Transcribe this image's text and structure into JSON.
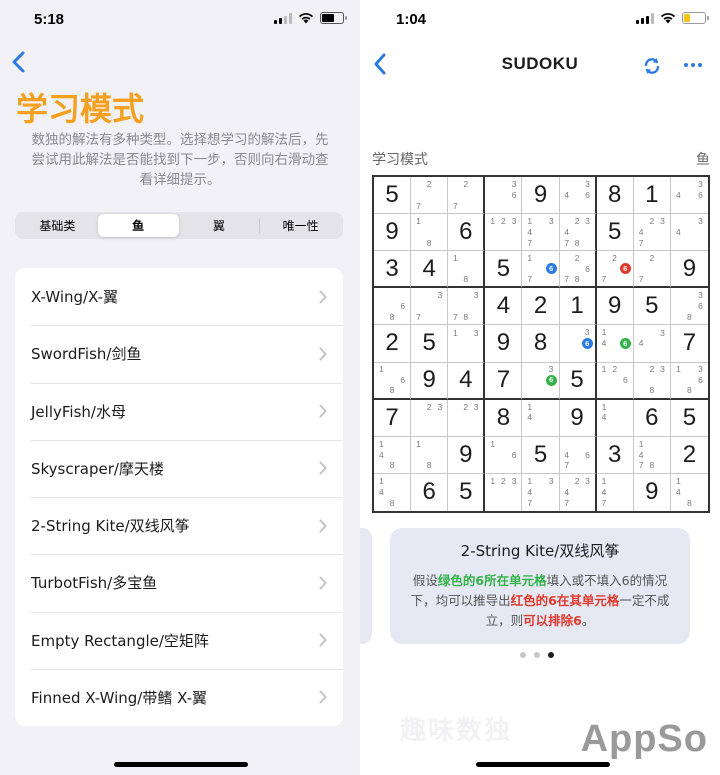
{
  "left": {
    "status": {
      "time": "5:18"
    },
    "title": "学习模式",
    "description": "数独的解法有多种类型。选择想学习的解法后，先尝试用此解法是否能找到下一步，否则向右滑动查看详细提示。",
    "segments": [
      "基础类",
      "鱼",
      "翼",
      "唯一性"
    ],
    "active_segment": 1,
    "items": [
      "X-Wing/X-翼",
      "SwordFish/剑鱼",
      "JellyFish/水母",
      "Skyscraper/摩天楼",
      "2-String Kite/双线风筝",
      "TurbotFish/多宝鱼",
      "Empty Rectangle/空矩阵",
      "Finned X-Wing/带鳍 X-翼"
    ]
  },
  "right": {
    "status": {
      "time": "1:04"
    },
    "title": "SUDOKU",
    "mode_label": "学习模式",
    "category_label": "鱼",
    "hint": {
      "title": "2-String Kite/双线风筝",
      "body_parts": [
        {
          "t": "假设",
          "c": ""
        },
        {
          "t": "绿色的6所在单元格",
          "c": "hg"
        },
        {
          "t": "填入或不填入6的情况下，均可以推导出",
          "c": ""
        },
        {
          "t": "红色的6在其单元格",
          "c": "hr"
        },
        {
          "t": "一定不成立，则",
          "c": ""
        },
        {
          "t": "可以排除6",
          "c": "hr"
        },
        {
          "t": "。",
          "c": ""
        }
      ]
    },
    "page_dots": 3,
    "active_dot": 2,
    "ghost_text": "趣味数独",
    "watermark": "AppSo"
  },
  "colors": {
    "accent_orange": "#f5a020",
    "ios_blue": "#2a7ae2",
    "green_highlight": "#34b24b",
    "red_highlight": "#e03a2c",
    "blue_highlight": "#2a7ae2"
  },
  "board": [
    [
      {
        "v": "5"
      },
      {
        "n": {
          "2": "2",
          "7": "7"
        }
      },
      {
        "n": {
          "2": "2",
          "7": "7"
        }
      },
      {
        "n": {
          "3": "3",
          "6": "6"
        }
      },
      {
        "v": "9"
      },
      {
        "n": {
          "3": "3",
          "4": "4",
          "6": "6"
        }
      },
      {
        "v": "8"
      },
      {
        "v": "1"
      },
      {
        "n": {
          "3": "3",
          "4": "4",
          "6": "6"
        }
      }
    ],
    [
      {
        "v": "9"
      },
      {
        "n": {
          "1": "1",
          "8": "8"
        }
      },
      {
        "v": "6"
      },
      {
        "n": {
          "1": "1",
          "2": "2",
          "3": "3"
        }
      },
      {
        "n": {
          "1": "1",
          "3": "3",
          "4": "4",
          "7": "7"
        }
      },
      {
        "n": {
          "2": "2",
          "3": "3",
          "4": "4",
          "7": "7",
          "8": "8"
        }
      },
      {
        "v": "5"
      },
      {
        "n": {
          "2": "2",
          "3": "3",
          "4": "4",
          "7": "7"
        }
      },
      {
        "n": {
          "3": "3",
          "4": "4"
        }
      }
    ],
    [
      {
        "v": "3"
      },
      {
        "v": "4"
      },
      {
        "n": {
          "1": "1",
          "8": "8"
        }
      },
      {
        "v": "5"
      },
      {
        "n": {
          "1": "1",
          "6": "6*b",
          "7": "7"
        }
      },
      {
        "n": {
          "2": "2",
          "6": "6",
          "7": "7",
          "8": "8"
        }
      },
      {
        "n": {
          "2": "2",
          "6": "6*r",
          "7": "7"
        }
      },
      {
        "n": {
          "2": "2",
          "7": "7"
        }
      },
      {
        "v": "9"
      }
    ],
    [
      {
        "n": {
          "6": "6",
          "8": "8"
        }
      },
      {
        "n": {
          "3": "3",
          "7": "7"
        }
      },
      {
        "n": {
          "3": "3",
          "7": "7",
          "8": "8"
        }
      },
      {
        "v": "4"
      },
      {
        "v": "2"
      },
      {
        "v": "1"
      },
      {
        "v": "9"
      },
      {
        "v": "5"
      },
      {
        "n": {
          "3": "3",
          "6": "6",
          "8": "8"
        }
      }
    ],
    [
      {
        "v": "2"
      },
      {
        "v": "5"
      },
      {
        "n": {
          "1": "1",
          "3": "3"
        }
      },
      {
        "v": "9"
      },
      {
        "v": "8"
      },
      {
        "n": {
          "3": "3",
          "6": "6*b"
        }
      },
      {
        "n": {
          "1": "1",
          "4": "4",
          "6": "6*g"
        }
      },
      {
        "n": {
          "3": "3",
          "4": "4"
        }
      },
      {
        "v": "7"
      }
    ],
    [
      {
        "n": {
          "1": "1",
          "6": "6",
          "8": "8"
        }
      },
      {
        "v": "9"
      },
      {
        "v": "4"
      },
      {
        "v": "7"
      },
      {
        "n": {
          "3": "3",
          "6": "6*g"
        }
      },
      {
        "v": "5"
      },
      {
        "n": {
          "1": "1",
          "2": "2",
          "6": "6"
        }
      },
      {
        "n": {
          "2": "2",
          "3": "3",
          "8": "8"
        }
      },
      {
        "n": {
          "1": "1",
          "3": "3",
          "6": "6",
          "8": "8"
        }
      }
    ],
    [
      {
        "v": "7"
      },
      {
        "n": {
          "2": "2",
          "3": "3"
        }
      },
      {
        "n": {
          "2": "2",
          "3": "3"
        }
      },
      {
        "v": "8"
      },
      {
        "n": {
          "1": "1",
          "4": "4"
        }
      },
      {
        "v": "9"
      },
      {
        "n": {
          "1": "1",
          "4": "4"
        }
      },
      {
        "v": "6"
      },
      {
        "v": "5"
      }
    ],
    [
      {
        "n": {
          "1": "1",
          "4": "4",
          "8": "8"
        }
      },
      {
        "n": {
          "1": "1",
          "8": "8"
        }
      },
      {
        "v": "9"
      },
      {
        "n": {
          "1": "1",
          "6": "6"
        }
      },
      {
        "v": "5"
      },
      {
        "n": {
          "4": "4",
          "6": "6",
          "7": "7"
        }
      },
      {
        "v": "3"
      },
      {
        "n": {
          "1": "1",
          "4": "4",
          "7": "7",
          "8": "8"
        }
      },
      {
        "v": "2"
      }
    ],
    [
      {
        "n": {
          "1": "1",
          "4": "4",
          "8": "8"
        }
      },
      {
        "v": "6"
      },
      {
        "v": "5"
      },
      {
        "n": {
          "1": "1",
          "2": "2",
          "3": "3"
        }
      },
      {
        "n": {
          "1": "1",
          "3": "3",
          "4": "4",
          "7": "7"
        }
      },
      {
        "n": {
          "2": "2",
          "3": "3",
          "4": "4",
          "7": "7"
        }
      },
      {
        "n": {
          "1": "1",
          "4": "4",
          "7": "7"
        }
      },
      {
        "v": "9"
      },
      {
        "n": {
          "1": "1",
          "4": "4",
          "8": "8"
        }
      }
    ]
  ]
}
